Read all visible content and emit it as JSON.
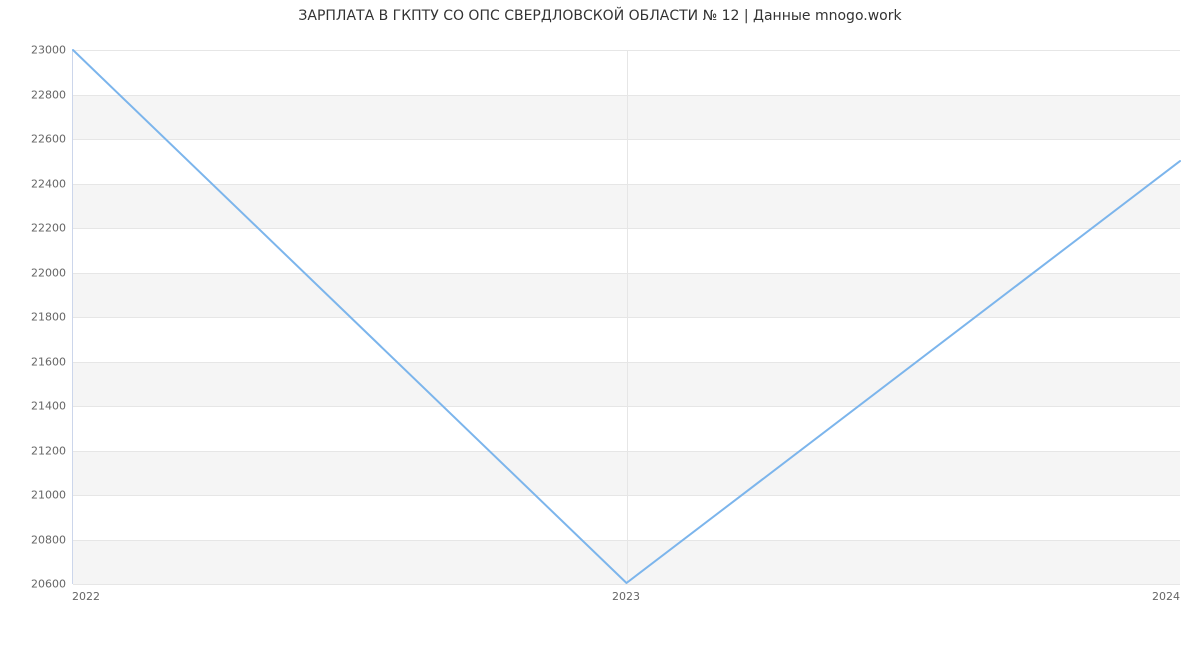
{
  "chart_data": {
    "type": "line",
    "title": "ЗАРПЛАТА В ГКПТУ СО ОПС СВЕРДЛОВСКОЙ ОБЛАСТИ № 12 | Данные mnogo.work",
    "x": [
      2022,
      2023,
      2024
    ],
    "values": [
      23000,
      20600,
      22500
    ],
    "xticks": [
      "2022",
      "2023",
      "2024"
    ],
    "yticks": [
      20600,
      20800,
      21000,
      21200,
      21400,
      21600,
      21800,
      22000,
      22200,
      22400,
      22600,
      22800,
      23000
    ],
    "ylim": [
      20600,
      23000
    ],
    "xlim": [
      2022,
      2024
    ],
    "xlabel": "",
    "ylabel": "",
    "line_color": "#7cb5ec"
  }
}
